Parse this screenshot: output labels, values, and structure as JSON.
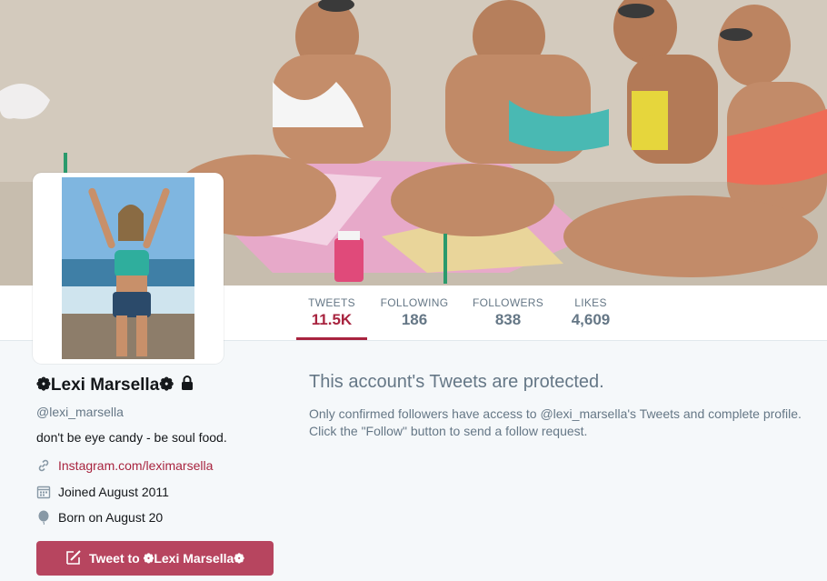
{
  "header": {
    "photo_description": "beach-group-photo"
  },
  "nav": {
    "stats": [
      {
        "label": "TWEETS",
        "value": "11.5K",
        "active": true
      },
      {
        "label": "FOLLOWING",
        "value": "186",
        "active": false
      },
      {
        "label": "FOLLOWERS",
        "value": "838",
        "active": false
      },
      {
        "label": "LIKES",
        "value": "4,609",
        "active": false
      }
    ]
  },
  "profile": {
    "name": "❁Lexi Marsella❁",
    "handle": "@lexi_marsella",
    "bio": "don't be eye candy - be soul food.",
    "link": "Instagram.com/leximarsella",
    "joined": "Joined August 2011",
    "born": "Born on August 20",
    "tweet_to_label": "Tweet to ❁Lexi Marsella❁"
  },
  "protected": {
    "title": "This account's Tweets are protected.",
    "line1": "Only confirmed followers have access to @lexi_marsella's Tweets and complete profile.",
    "line2": "Click the \"Follow\" button to send a follow request."
  },
  "colors": {
    "accent": "#a8243f",
    "button": "#b7455f",
    "muted": "#657786",
    "background": "#f5f8fa"
  },
  "icons": {
    "lock": "lock-icon",
    "link": "link-icon",
    "calendar": "calendar-icon",
    "balloon": "balloon-icon",
    "compose": "compose-icon"
  }
}
